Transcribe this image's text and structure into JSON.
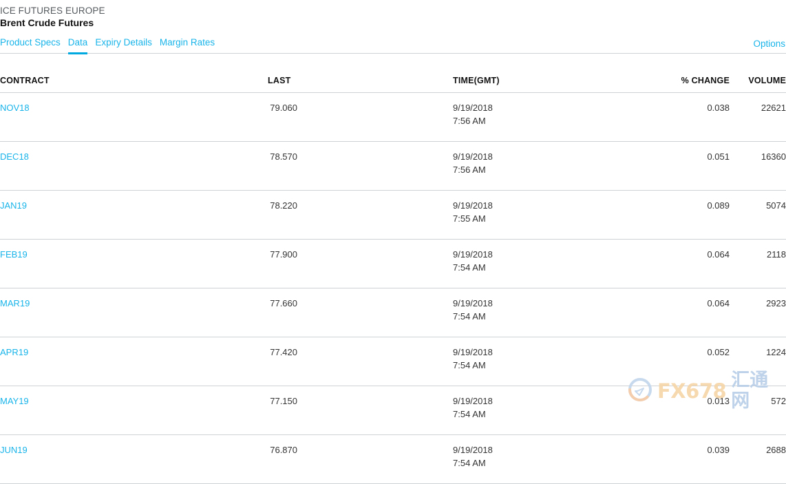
{
  "header": {
    "exchange": "ICE FUTURES EUROPE",
    "product_title": "Brent Crude Futures"
  },
  "tabs": [
    {
      "label": "Product Specs",
      "active": false
    },
    {
      "label": "Data",
      "active": true
    },
    {
      "label": "Expiry Details",
      "active": false
    },
    {
      "label": "Margin Rates",
      "active": false
    }
  ],
  "options_link": "Options",
  "table": {
    "columns": [
      "CONTRACT",
      "LAST",
      "TIME(GMT)",
      "% CHANGE",
      "VOLUME"
    ],
    "rows": [
      {
        "contract": "NOV18",
        "last": "79.060",
        "date": "9/19/2018",
        "time": "7:56 AM",
        "change": "0.038",
        "volume": "22621"
      },
      {
        "contract": "DEC18",
        "last": "78.570",
        "date": "9/19/2018",
        "time": "7:56 AM",
        "change": "0.051",
        "volume": "16360"
      },
      {
        "contract": "JAN19",
        "last": "78.220",
        "date": "9/19/2018",
        "time": "7:55 AM",
        "change": "0.089",
        "volume": "5074"
      },
      {
        "contract": "FEB19",
        "last": "77.900",
        "date": "9/19/2018",
        "time": "7:54 AM",
        "change": "0.064",
        "volume": "2118"
      },
      {
        "contract": "MAR19",
        "last": "77.660",
        "date": "9/19/2018",
        "time": "7:54 AM",
        "change": "0.064",
        "volume": "2923"
      },
      {
        "contract": "APR19",
        "last": "77.420",
        "date": "9/19/2018",
        "time": "7:54 AM",
        "change": "0.052",
        "volume": "1224"
      },
      {
        "contract": "MAY19",
        "last": "77.150",
        "date": "9/19/2018",
        "time": "7:54 AM",
        "change": "0.013",
        "volume": "572"
      },
      {
        "contract": "JUN19",
        "last": "76.870",
        "date": "9/19/2018",
        "time": "7:54 AM",
        "change": "0.039",
        "volume": "2688"
      }
    ]
  },
  "watermark": {
    "logo_icon": "fx678-swirl-logo-icon",
    "text_latin": "FX678",
    "text_chinese": "汇通网"
  },
  "colors": {
    "link_blue": "#18b4e9",
    "tab_active_underline": "#00a9e0",
    "divider": "#cfd2d4",
    "text": "#222222",
    "background": "#ffffff"
  }
}
